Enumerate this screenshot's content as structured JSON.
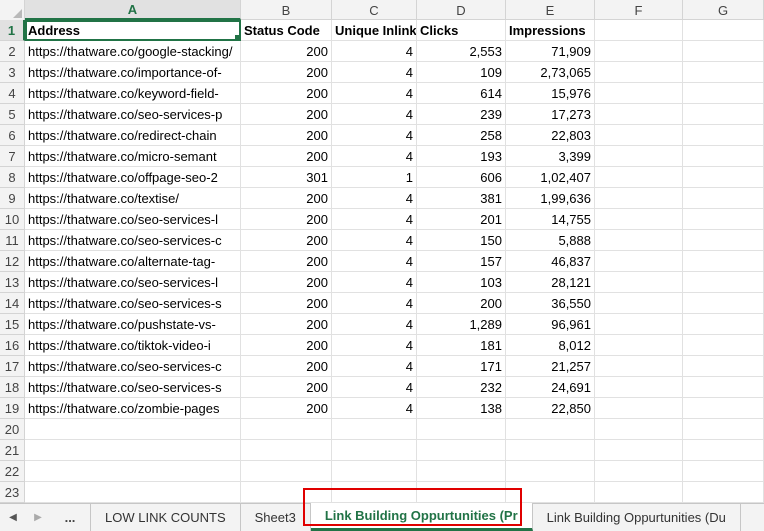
{
  "columns": [
    "A",
    "B",
    "C",
    "D",
    "E",
    "F",
    "G"
  ],
  "header_row": {
    "row_number": "1",
    "address": "Address",
    "status": "Status Code",
    "inlinks": "Unique Inlinks",
    "clicks": "Clicks",
    "impressions": "Impressions"
  },
  "rows": [
    {
      "n": "2",
      "address": "https://thatware.co/google-stacking/",
      "status": "200",
      "inlinks": "4",
      "clicks": "2,553",
      "impressions": "71,909"
    },
    {
      "n": "3",
      "address": "https://thatware.co/importance-of-",
      "status": "200",
      "inlinks": "4",
      "clicks": "109",
      "impressions": "2,73,065"
    },
    {
      "n": "4",
      "address": "https://thatware.co/keyword-field-",
      "status": "200",
      "inlinks": "4",
      "clicks": "614",
      "impressions": "15,976"
    },
    {
      "n": "5",
      "address": "https://thatware.co/seo-services-p",
      "status": "200",
      "inlinks": "4",
      "clicks": "239",
      "impressions": "17,273"
    },
    {
      "n": "6",
      "address": "https://thatware.co/redirect-chain",
      "status": "200",
      "inlinks": "4",
      "clicks": "258",
      "impressions": "22,803"
    },
    {
      "n": "7",
      "address": "https://thatware.co/micro-semant",
      "status": "200",
      "inlinks": "4",
      "clicks": "193",
      "impressions": "3,399"
    },
    {
      "n": "8",
      "address": "https://thatware.co/offpage-seo-2",
      "status": "301",
      "inlinks": "1",
      "clicks": "606",
      "impressions": "1,02,407"
    },
    {
      "n": "9",
      "address": "https://thatware.co/textise/",
      "status": "200",
      "inlinks": "4",
      "clicks": "381",
      "impressions": "1,99,636"
    },
    {
      "n": "10",
      "address": "https://thatware.co/seo-services-l",
      "status": "200",
      "inlinks": "4",
      "clicks": "201",
      "impressions": "14,755"
    },
    {
      "n": "11",
      "address": "https://thatware.co/seo-services-c",
      "status": "200",
      "inlinks": "4",
      "clicks": "150",
      "impressions": "5,888"
    },
    {
      "n": "12",
      "address": "https://thatware.co/alternate-tag-",
      "status": "200",
      "inlinks": "4",
      "clicks": "157",
      "impressions": "46,837"
    },
    {
      "n": "13",
      "address": "https://thatware.co/seo-services-l",
      "status": "200",
      "inlinks": "4",
      "clicks": "103",
      "impressions": "28,121"
    },
    {
      "n": "14",
      "address": "https://thatware.co/seo-services-s",
      "status": "200",
      "inlinks": "4",
      "clicks": "200",
      "impressions": "36,550"
    },
    {
      "n": "15",
      "address": "https://thatware.co/pushstate-vs-",
      "status": "200",
      "inlinks": "4",
      "clicks": "1,289",
      "impressions": "96,961"
    },
    {
      "n": "16",
      "address": "https://thatware.co/tiktok-video-i",
      "status": "200",
      "inlinks": "4",
      "clicks": "181",
      "impressions": "8,012"
    },
    {
      "n": "17",
      "address": "https://thatware.co/seo-services-c",
      "status": "200",
      "inlinks": "4",
      "clicks": "171",
      "impressions": "21,257"
    },
    {
      "n": "18",
      "address": "https://thatware.co/seo-services-s",
      "status": "200",
      "inlinks": "4",
      "clicks": "232",
      "impressions": "24,691"
    },
    {
      "n": "19",
      "address": "https://thatware.co/zombie-pages",
      "status": "200",
      "inlinks": "4",
      "clicks": "138",
      "impressions": "22,850"
    }
  ],
  "empty_rows": [
    "20",
    "21",
    "22",
    "23"
  ],
  "tabs": {
    "prev_icon": "triangle-left-icon",
    "next_icon": "triangle-right-icon",
    "more": "...",
    "items": [
      {
        "label": "LOW LINK COUNTS"
      },
      {
        "label": "Sheet3"
      },
      {
        "label": "Link Building Oppurtunities (Pr"
      },
      {
        "label": "Link Building Oppurtunities (Du"
      }
    ],
    "active_index": 2
  },
  "colors": {
    "accent": "#217346",
    "highlight": "#e00000"
  }
}
